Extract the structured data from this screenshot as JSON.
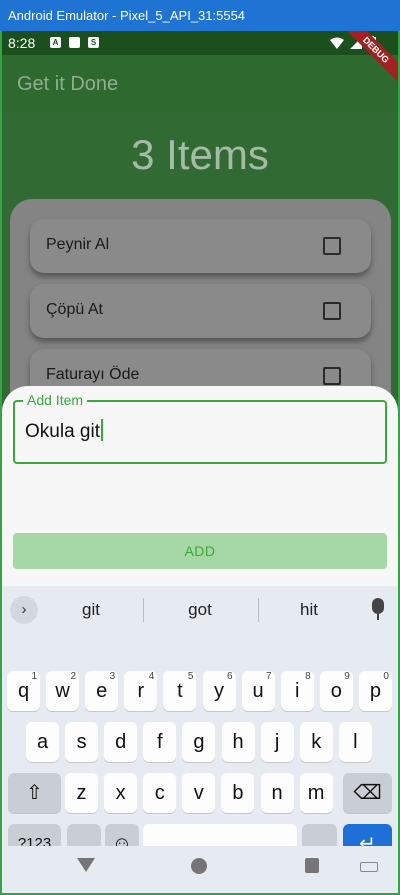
{
  "window": {
    "title": "Android Emulator - Pixel_5_API_31:5554"
  },
  "status_bar": {
    "time": "8:28",
    "debug_label": "DEBUG"
  },
  "app_bar": {
    "title": "Get it Done"
  },
  "main": {
    "count_title": "3 Items",
    "items": [
      {
        "label": "Peynir Al"
      },
      {
        "label": "Çöpü At"
      },
      {
        "label": "Faturayı Öde"
      }
    ]
  },
  "sheet": {
    "field_label": "Add Item",
    "field_value": "Okula git",
    "add_button": "ADD"
  },
  "keyboard": {
    "suggestions": [
      "git",
      "got",
      "hit"
    ],
    "row1": [
      {
        "k": "q",
        "h": "1"
      },
      {
        "k": "w",
        "h": "2"
      },
      {
        "k": "e",
        "h": "3"
      },
      {
        "k": "r",
        "h": "4"
      },
      {
        "k": "t",
        "h": "5"
      },
      {
        "k": "y",
        "h": "6"
      },
      {
        "k": "u",
        "h": "7"
      },
      {
        "k": "i",
        "h": "8"
      },
      {
        "k": "o",
        "h": "9"
      },
      {
        "k": "p",
        "h": "0"
      }
    ],
    "row2": [
      "a",
      "s",
      "d",
      "f",
      "g",
      "h",
      "j",
      "k",
      "l"
    ],
    "row3": [
      "z",
      "x",
      "c",
      "v",
      "b",
      "n",
      "m"
    ],
    "sym_label": "?123",
    "comma": ",",
    "period": ".",
    "enter_glyph": "↵",
    "backspace_glyph": "⌫",
    "shift_glyph": "⇧",
    "emoji_glyph": "☺",
    "chevron_glyph": "›"
  },
  "colors": {
    "accent": "#3aa83e",
    "app_bar": "#2e6a30",
    "enter_key": "#1e6fd6"
  }
}
